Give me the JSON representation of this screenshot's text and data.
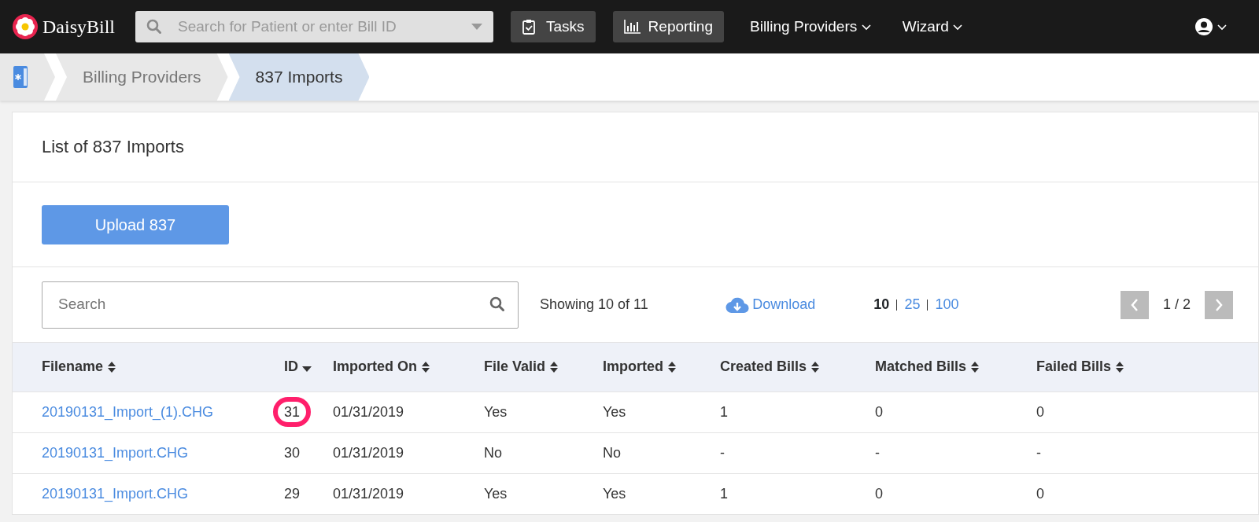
{
  "navbar": {
    "brand": "DaisyBill",
    "search_placeholder": "Search for Patient or enter Bill ID",
    "buttons": [
      {
        "label": "Tasks",
        "kind": "tasks"
      },
      {
        "label": "Reporting",
        "kind": "reporting"
      }
    ],
    "menus": [
      "Billing Providers",
      "Wizard"
    ]
  },
  "breadcrumb": [
    {
      "label": "Billing Providers",
      "selected": false
    },
    {
      "label": "837 Imports",
      "selected": true
    }
  ],
  "card": {
    "title": "List of 837 Imports",
    "upload_button": "Upload 837"
  },
  "toolbar": {
    "search_placeholder": "Search",
    "showing": "Showing 10 of 11",
    "download": "Download",
    "page_sizes": [
      {
        "label": "10",
        "selected": true
      },
      {
        "label": "25",
        "selected": false
      },
      {
        "label": "100",
        "selected": false
      }
    ],
    "page": "1 / 2"
  },
  "table": {
    "columns": [
      {
        "label": "Filename",
        "sorted": false
      },
      {
        "label": "ID",
        "sorted": true
      },
      {
        "label": "Imported On",
        "sorted": false
      },
      {
        "label": "File Valid",
        "sorted": false
      },
      {
        "label": "Imported",
        "sorted": false
      },
      {
        "label": "Created Bills",
        "sorted": false
      },
      {
        "label": "Matched Bills",
        "sorted": false
      },
      {
        "label": "Failed Bills",
        "sorted": false
      }
    ],
    "rows": [
      {
        "cells": [
          "20190131_Import_(1).CHG",
          "31",
          "01/31/2019",
          "Yes",
          "Yes",
          "1",
          "0",
          "0"
        ],
        "id_circled": true
      },
      {
        "cells": [
          "20190131_Import.CHG",
          "30",
          "01/31/2019",
          "No",
          "No",
          "-",
          "-",
          "-"
        ],
        "id_circled": false
      },
      {
        "cells": [
          "20190131_Import.CHG",
          "29",
          "01/31/2019",
          "Yes",
          "Yes",
          "1",
          "0",
          "0"
        ],
        "id_circled": false
      }
    ]
  }
}
